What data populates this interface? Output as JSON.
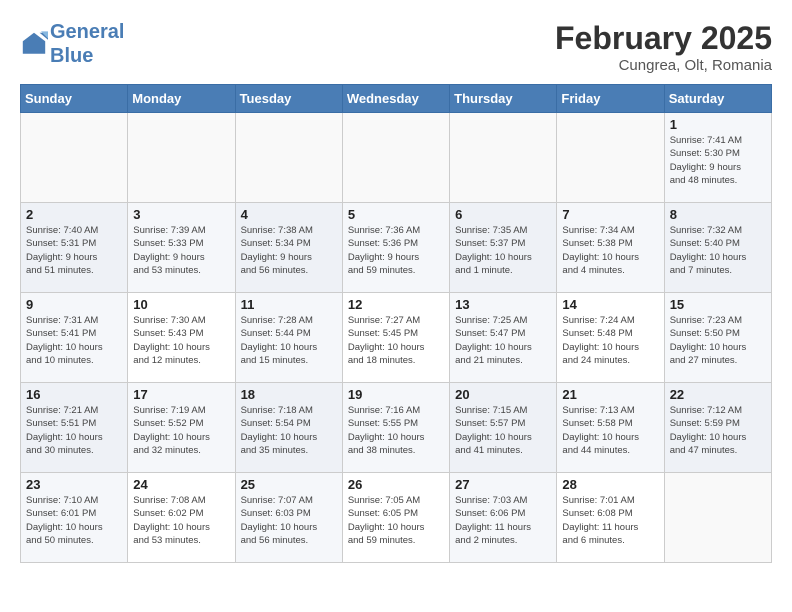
{
  "header": {
    "logo_line1": "General",
    "logo_line2": "Blue",
    "month": "February 2025",
    "location": "Cungrea, Olt, Romania"
  },
  "weekdays": [
    "Sunday",
    "Monday",
    "Tuesday",
    "Wednesday",
    "Thursday",
    "Friday",
    "Saturday"
  ],
  "weeks": [
    [
      {
        "day": "",
        "info": ""
      },
      {
        "day": "",
        "info": ""
      },
      {
        "day": "",
        "info": ""
      },
      {
        "day": "",
        "info": ""
      },
      {
        "day": "",
        "info": ""
      },
      {
        "day": "",
        "info": ""
      },
      {
        "day": "1",
        "info": "Sunrise: 7:41 AM\nSunset: 5:30 PM\nDaylight: 9 hours\nand 48 minutes."
      }
    ],
    [
      {
        "day": "2",
        "info": "Sunrise: 7:40 AM\nSunset: 5:31 PM\nDaylight: 9 hours\nand 51 minutes."
      },
      {
        "day": "3",
        "info": "Sunrise: 7:39 AM\nSunset: 5:33 PM\nDaylight: 9 hours\nand 53 minutes."
      },
      {
        "day": "4",
        "info": "Sunrise: 7:38 AM\nSunset: 5:34 PM\nDaylight: 9 hours\nand 56 minutes."
      },
      {
        "day": "5",
        "info": "Sunrise: 7:36 AM\nSunset: 5:36 PM\nDaylight: 9 hours\nand 59 minutes."
      },
      {
        "day": "6",
        "info": "Sunrise: 7:35 AM\nSunset: 5:37 PM\nDaylight: 10 hours\nand 1 minute."
      },
      {
        "day": "7",
        "info": "Sunrise: 7:34 AM\nSunset: 5:38 PM\nDaylight: 10 hours\nand 4 minutes."
      },
      {
        "day": "8",
        "info": "Sunrise: 7:32 AM\nSunset: 5:40 PM\nDaylight: 10 hours\nand 7 minutes."
      }
    ],
    [
      {
        "day": "9",
        "info": "Sunrise: 7:31 AM\nSunset: 5:41 PM\nDaylight: 10 hours\nand 10 minutes."
      },
      {
        "day": "10",
        "info": "Sunrise: 7:30 AM\nSunset: 5:43 PM\nDaylight: 10 hours\nand 12 minutes."
      },
      {
        "day": "11",
        "info": "Sunrise: 7:28 AM\nSunset: 5:44 PM\nDaylight: 10 hours\nand 15 minutes."
      },
      {
        "day": "12",
        "info": "Sunrise: 7:27 AM\nSunset: 5:45 PM\nDaylight: 10 hours\nand 18 minutes."
      },
      {
        "day": "13",
        "info": "Sunrise: 7:25 AM\nSunset: 5:47 PM\nDaylight: 10 hours\nand 21 minutes."
      },
      {
        "day": "14",
        "info": "Sunrise: 7:24 AM\nSunset: 5:48 PM\nDaylight: 10 hours\nand 24 minutes."
      },
      {
        "day": "15",
        "info": "Sunrise: 7:23 AM\nSunset: 5:50 PM\nDaylight: 10 hours\nand 27 minutes."
      }
    ],
    [
      {
        "day": "16",
        "info": "Sunrise: 7:21 AM\nSunset: 5:51 PM\nDaylight: 10 hours\nand 30 minutes."
      },
      {
        "day": "17",
        "info": "Sunrise: 7:19 AM\nSunset: 5:52 PM\nDaylight: 10 hours\nand 32 minutes."
      },
      {
        "day": "18",
        "info": "Sunrise: 7:18 AM\nSunset: 5:54 PM\nDaylight: 10 hours\nand 35 minutes."
      },
      {
        "day": "19",
        "info": "Sunrise: 7:16 AM\nSunset: 5:55 PM\nDaylight: 10 hours\nand 38 minutes."
      },
      {
        "day": "20",
        "info": "Sunrise: 7:15 AM\nSunset: 5:57 PM\nDaylight: 10 hours\nand 41 minutes."
      },
      {
        "day": "21",
        "info": "Sunrise: 7:13 AM\nSunset: 5:58 PM\nDaylight: 10 hours\nand 44 minutes."
      },
      {
        "day": "22",
        "info": "Sunrise: 7:12 AM\nSunset: 5:59 PM\nDaylight: 10 hours\nand 47 minutes."
      }
    ],
    [
      {
        "day": "23",
        "info": "Sunrise: 7:10 AM\nSunset: 6:01 PM\nDaylight: 10 hours\nand 50 minutes."
      },
      {
        "day": "24",
        "info": "Sunrise: 7:08 AM\nSunset: 6:02 PM\nDaylight: 10 hours\nand 53 minutes."
      },
      {
        "day": "25",
        "info": "Sunrise: 7:07 AM\nSunset: 6:03 PM\nDaylight: 10 hours\nand 56 minutes."
      },
      {
        "day": "26",
        "info": "Sunrise: 7:05 AM\nSunset: 6:05 PM\nDaylight: 10 hours\nand 59 minutes."
      },
      {
        "day": "27",
        "info": "Sunrise: 7:03 AM\nSunset: 6:06 PM\nDaylight: 11 hours\nand 2 minutes."
      },
      {
        "day": "28",
        "info": "Sunrise: 7:01 AM\nSunset: 6:08 PM\nDaylight: 11 hours\nand 6 minutes."
      },
      {
        "day": "",
        "info": ""
      }
    ]
  ]
}
